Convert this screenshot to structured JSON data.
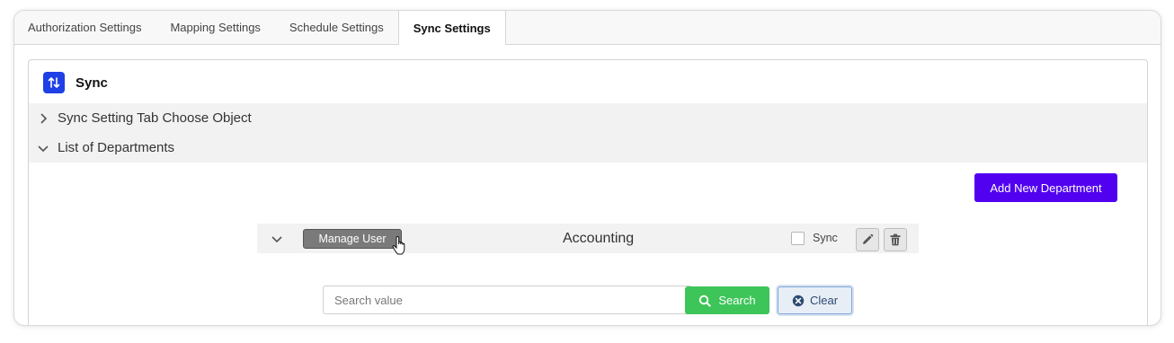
{
  "tabs": [
    {
      "label": "Authorization Settings",
      "active": false
    },
    {
      "label": "Mapping Settings",
      "active": false
    },
    {
      "label": "Schedule Settings",
      "active": false
    },
    {
      "label": "Sync Settings",
      "active": true
    }
  ],
  "card": {
    "title": "Sync",
    "icon": "sync-arrows-icon",
    "accent_color": "#1e40e6"
  },
  "accordion": [
    {
      "label": "Sync Setting Tab Choose Object",
      "expanded": false
    },
    {
      "label": "List of Departments",
      "expanded": true
    }
  ],
  "add_department_label": "Add New Department",
  "department": {
    "name": "Accounting",
    "manage_user_label": "Manage User",
    "sync_label": "Sync",
    "sync_checked": false
  },
  "search": {
    "placeholder": "Search value",
    "value": "",
    "search_label": "Search",
    "clear_label": "Clear"
  },
  "colors": {
    "add_button": "#5200f0",
    "search_button": "#3ec55a",
    "clear_button_border": "#7fa7d6"
  }
}
